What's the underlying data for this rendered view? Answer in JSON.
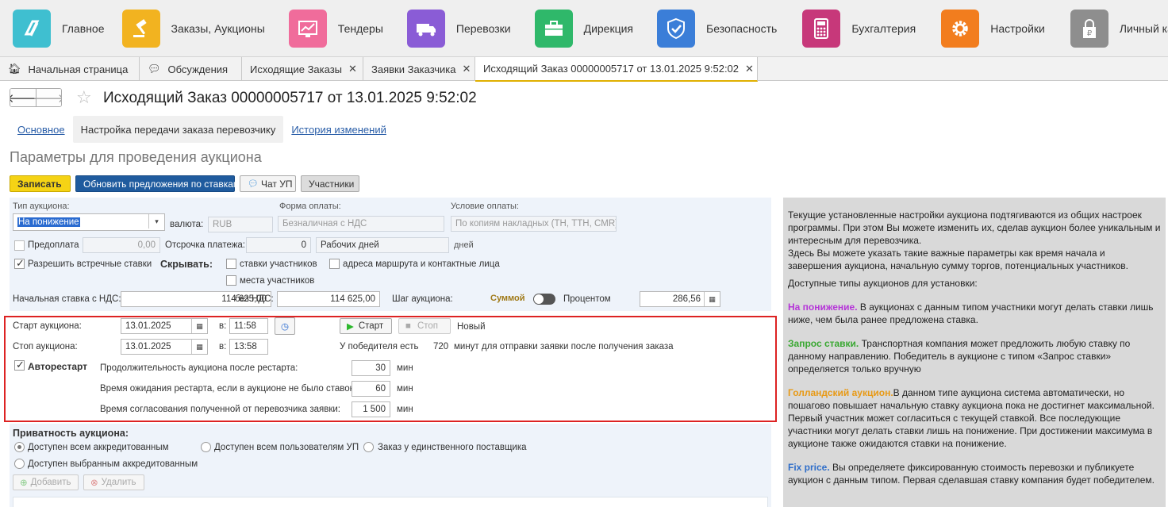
{
  "sections": [
    {
      "label": "Главное",
      "icon": "logo-icon",
      "color": "#3fbfd0"
    },
    {
      "label": "Заказы, Аукционы",
      "icon": "gavel-icon",
      "color": "#f2b320"
    },
    {
      "label": "Тендеры",
      "icon": "chart-icon",
      "color": "#f06c9b"
    },
    {
      "label": "Перевозки",
      "icon": "truck-icon",
      "color": "#8a5cd6"
    },
    {
      "label": "Дирекция",
      "icon": "briefcase-icon",
      "color": "#2fb86a"
    },
    {
      "label": "Безопасность",
      "icon": "shield-icon",
      "color": "#3b7ed8"
    },
    {
      "label": "Бухгалтерия",
      "icon": "calculator-icon",
      "color": "#c7387a"
    },
    {
      "label": "Настройки",
      "icon": "gear-icon",
      "color": "#f27d1e"
    },
    {
      "label": "Личный кабинет",
      "icon": "lock-ruble-icon",
      "color": "#8e8e8e"
    }
  ],
  "tabs": [
    {
      "label": "Начальная страница",
      "icon": "home-icon",
      "closable": false
    },
    {
      "label": "Обсуждения",
      "icon": "chat-icon",
      "closable": false
    },
    {
      "label": "Исходящие Заказы",
      "closable": true
    },
    {
      "label": "Заявки Заказчика",
      "closable": true
    },
    {
      "label": "Исходящий Заказ 00000005717 от 13.01.2025 9:52:02",
      "closable": true,
      "active": true
    }
  ],
  "header": {
    "title": "Исходящий Заказ 00000005717 от 13.01.2025 9:52:02",
    "back": "🡐",
    "forward": "🡒",
    "star": "☆"
  },
  "subtabs": [
    "Основное",
    "Настройка передачи заказа перевозчику",
    "История изменений"
  ],
  "section_title": "Параметры для проведения аукциона",
  "toolbar": {
    "save": "Записать",
    "refresh": "Обновить предложения по ставкам",
    "chat": "Чат УП",
    "participants": "Участники"
  },
  "form": {
    "auction_type_label": "Тип аукциона:",
    "auction_type_value": "На понижение",
    "currency_label": "валюта:",
    "currency_value": "RUB",
    "payment_form_label": "Форма оплаты:",
    "payment_form_value": "Безналичная с НДС",
    "payment_terms_label": "Условие оплаты:",
    "payment_terms_value": "По копиям накладных (ТН, ТТН, CMR)",
    "prepay_label": "Предоплата",
    "prepay_value": "0,00",
    "deferral_label": "Отсрочка платежа:",
    "deferral_value": "0",
    "deferral_unit_value": "Рабочих дней",
    "days_label": "дней",
    "counter_bids_label": "Разрешить встречные ставки",
    "hide_label": "Скрывать:",
    "hide_bids_label": "ставки участников",
    "hide_route_label": "адреса маршрута и контактные лица",
    "hide_places_label": "места участников",
    "start_bid_label": "Начальная ставка с НДС:",
    "start_bid_value": "114 625,00",
    "no_vat_label": "без НДС:",
    "no_vat_value": "114 625,00",
    "step_label": "Шаг аукциона:",
    "step_sum_label": "Суммой",
    "step_percent_label": "Процентом",
    "step_value": "286,56",
    "start_label": "Старт аукциона:",
    "start_date": "13.01.2025",
    "at_label": "в:",
    "start_time": "11:58",
    "stop_label": "Стоп аукциона:",
    "stop_date": "13.01.2025",
    "stop_time": "13:58",
    "start_btn": "Старт",
    "stop_btn": "Стоп",
    "status_value": "Новый",
    "winner_label": "У победителя есть",
    "winner_minutes": "720",
    "winner_suffix": "минут для отправки заявки после получения заказа",
    "autorestart_label": "Авторестарт",
    "duration_label": "Продолжительность аукциона после рестарта:",
    "duration_value": "30",
    "wait_label": "Время ожидания рестарта, если в аукционе не было ставок:",
    "wait_value": "60",
    "approve_label": "Время согласования полученной от перевозчика заявки:",
    "approve_value": "1 500",
    "min_label": "мин",
    "privacy_label": "Приватность аукциона:",
    "privacy_all_accredited": "Доступен всем аккредитованным",
    "privacy_all_users": "Доступен всем пользователям УП",
    "privacy_single": "Заказ у единственного поставщика",
    "privacy_selected": "Доступен выбранным аккредитованным",
    "add_btn": "Добавить",
    "delete_btn": "Удалить"
  },
  "info": {
    "p1": "Текущие установленные настройки аукциона подтягиваются из общих настроек программы. При этом Вы можете изменить их, сделав аукцион более уникальным и интересным для перевозчика.",
    "p2": "Здесь Вы можете указать такие важные параметры как время начала и завершения аукциона, начальную сумму торгов, потенциальных участников.",
    "p3": "Доступные типы аукционов для установки:",
    "t1_name": "На понижение.",
    "t1_text": " В аукционах с данным типом участники могут делать ставки лишь ниже, чем была ранее предложена ставка.",
    "t2_name": "Запрос ставки.",
    "t2_text": " Транспортная компания может предложить любую ставку по данному направлению. Победитель в аукционе с типом «Запрос ставки» определяется только вручную",
    "t3_name": "Голландский аукцион.",
    "t3_text": "В данном типе аукциона система автоматически, но пошагово повышает начальную ставку аукциона пока не достигнет максимальной. Первый участник может согласиться с текущей ставкой. Все последующие участники могут делать ставки лишь на понижение. При достижении максимума в аукционе также ожидаются ставки на понижение.",
    "t4_name": "Fix price.",
    "t4_text": " Вы определяете фиксированную стоимость перевозки и публикуете аукцион с данным типом. Первая сделавшая ставку компания будет победителем."
  },
  "colors": {
    "accent_yellow": "#f5d315",
    "accent_blue": "#1f5b9e",
    "highlight_red": "#dd2222"
  }
}
